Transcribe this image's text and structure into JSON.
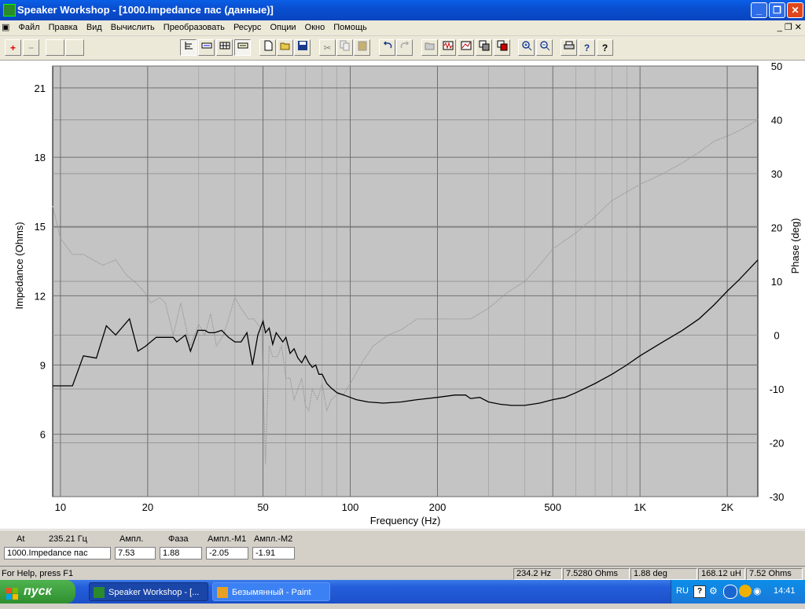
{
  "window": {
    "title": "Speaker Workshop - [1000.Impedance пас  (данные)]",
    "minimize_glyph": "_",
    "maximize_glyph": "❐",
    "close_glyph": "✕"
  },
  "menu": {
    "items": [
      "Файл",
      "Правка",
      "Вид",
      "Вычислить",
      "Преобразовать",
      "Ресурс",
      "Опции",
      "Окно",
      "Помощь"
    ],
    "mdi_controls": "_ ❐ ✕"
  },
  "toolbar": {
    "add_glyph": "+",
    "remove_glyph": "−",
    "icons": [
      "view-icon",
      "graph-icon",
      "grid-icon",
      "table-icon",
      "new-file-icon",
      "open-folder-icon",
      "save-icon",
      "cut-icon",
      "copy-icon",
      "paste-icon",
      "undo-icon",
      "redo-icon",
      "open-icon",
      "waveform-icon",
      "chart-icon",
      "measure-icon",
      "driver-icon",
      "zoom-in-icon",
      "zoom-out-icon",
      "print-icon",
      "help-icon",
      "context-help-icon"
    ],
    "help_glyph": "?",
    "context_help_glyph": "?"
  },
  "chart_data": {
    "type": "line",
    "xlabel": "Frequency (Hz)",
    "ylabel": "Impedance (Ohms)",
    "y2label": "Phase (deg)",
    "xscale": "log",
    "xlim": [
      9.4,
      2550
    ],
    "ylim": [
      3.3,
      21.95
    ],
    "y2lim": [
      -30,
      50
    ],
    "x_ticks": [
      {
        "v": 10,
        "label": "10"
      },
      {
        "v": 20,
        "label": "20"
      },
      {
        "v": 50,
        "label": "50"
      },
      {
        "v": 100,
        "label": "100"
      },
      {
        "v": 200,
        "label": "200"
      },
      {
        "v": 500,
        "label": "500"
      },
      {
        "v": 1000,
        "label": "1K"
      },
      {
        "v": 2000,
        "label": "2K"
      }
    ],
    "y_ticks": [
      6,
      9,
      12,
      15,
      18,
      21
    ],
    "y2_ticks": [
      -30,
      -20,
      -10,
      0,
      10,
      20,
      30,
      40,
      50
    ],
    "grid": true,
    "series": [
      {
        "name": "Impedance",
        "axis": "left",
        "color": "#000000",
        "x": [
          9.4,
          11,
          12,
          13.3,
          14.4,
          15.5,
          17.3,
          18.5,
          19.6,
          21.4,
          22.6,
          24.5,
          25.2,
          27,
          28.1,
          29.8,
          31.5,
          32.5,
          34,
          36,
          38,
          40,
          42,
          44,
          46,
          48,
          49,
          50,
          51,
          52.5,
          54,
          55.5,
          57,
          58.5,
          60,
          62,
          64,
          66,
          68,
          70,
          72,
          74,
          76,
          78,
          80,
          83,
          86,
          90,
          95,
          100,
          105,
          115,
          130,
          150,
          170,
          200,
          230,
          250,
          260,
          280,
          300,
          330,
          360,
          400,
          450,
          500,
          550,
          600,
          700,
          800,
          900,
          1000,
          1200,
          1400,
          1600,
          1800,
          2000,
          2200,
          2400,
          2550
        ],
        "values": [
          8.1,
          8.1,
          9.4,
          9.3,
          10.7,
          10.3,
          11,
          9.6,
          9.8,
          10.2,
          10.2,
          10.2,
          10.0,
          10.3,
          9.6,
          10.5,
          10.5,
          10.4,
          10.4,
          10.5,
          10.2,
          10.0,
          10.0,
          10.4,
          9.0,
          10.3,
          10.6,
          10.9,
          10.4,
          10.6,
          9.9,
          10.4,
          10.2,
          10.0,
          10.2,
          9.5,
          9.7,
          9.3,
          9.1,
          9.4,
          9.1,
          8.9,
          9.0,
          8.6,
          8.6,
          8.2,
          8.0,
          7.8,
          7.7,
          7.6,
          7.5,
          7.4,
          7.35,
          7.4,
          7.5,
          7.6,
          7.7,
          7.7,
          7.55,
          7.6,
          7.4,
          7.3,
          7.25,
          7.25,
          7.35,
          7.5,
          7.6,
          7.8,
          8.2,
          8.6,
          9.0,
          9.4,
          10.0,
          10.5,
          11.0,
          11.6,
          12.2,
          12.7,
          13.2,
          13.55
        ]
      },
      {
        "name": "Phase",
        "axis": "right",
        "color": "#9a9a9a",
        "x": [
          9.4,
          10,
          11,
          12,
          14,
          15.5,
          17,
          18,
          19.5,
          20.5,
          22,
          23,
          24.5,
          26,
          28,
          30,
          31.5,
          33,
          34.5,
          36.5,
          38,
          40,
          42,
          44.5,
          46.5,
          48,
          49.5,
          50,
          51,
          52.5,
          54,
          56,
          58,
          60,
          62,
          64,
          66,
          68,
          70,
          72,
          74,
          77,
          80,
          83,
          86,
          90,
          95,
          100,
          105,
          110,
          120,
          135,
          150,
          170,
          200,
          230,
          260,
          300,
          350,
          400,
          450,
          500,
          600,
          700,
          800,
          1000,
          1200,
          1400,
          1600,
          1800,
          2000,
          2200,
          2550
        ],
        "values": [
          24,
          18,
          15,
          15,
          13,
          14,
          11,
          10,
          8,
          6,
          7,
          6,
          0,
          6,
          -2,
          2,
          0,
          4,
          -2,
          0,
          3,
          7,
          5,
          3,
          3,
          2,
          1,
          -8,
          -24,
          -2,
          -4,
          -4,
          -2,
          -8,
          -8,
          -12,
          -10,
          -8,
          -13,
          -14,
          -10,
          -12,
          -9,
          -14,
          -12,
          -11,
          -11,
          -9,
          -7,
          -5,
          -2,
          0,
          1,
          3,
          3,
          3,
          3,
          5,
          8,
          10,
          13,
          16,
          19,
          22,
          25,
          28,
          30,
          32,
          34,
          36,
          37,
          38,
          40
        ]
      }
    ]
  },
  "panel": {
    "at_label": "At",
    "freq_value": "235.21 Гц",
    "curve_name": "1000.Impedance пас",
    "amp_label": "Ампл.",
    "amp_value": "7.53",
    "phase_label": "Фаза",
    "phase_value": "1.88",
    "m1_label": "Ампл.-М1",
    "m1_value": "-2.05",
    "m2_label": "Ампл.-М2",
    "m2_value": "-1.91"
  },
  "statusbar": {
    "help_text": "For Help, press F1",
    "freq": "234.2 Hz",
    "ohms": "7.5280 Ohms",
    "deg": "1.88 deg",
    "induct": "168.12 uH",
    "ohms2": "7.52 Ohms"
  },
  "taskbar": {
    "start_label": "пуск",
    "task1": "Speaker Workshop - [...",
    "task2": "Безымянный - Paint",
    "lang": "RU",
    "clock": "14:41"
  },
  "colors": {
    "plot_background": "#c4c4c4",
    "grid": "#707070",
    "titlebar": "#0a4fd0",
    "taskbar": "#245edb"
  }
}
